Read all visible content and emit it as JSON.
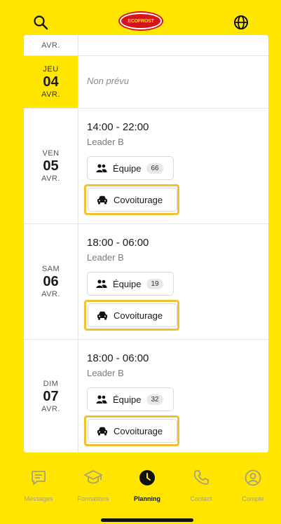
{
  "header": {
    "logo_text": "ECOFROST"
  },
  "colors": {
    "accent": "#ffe500",
    "highlight": "#f2c12e",
    "logo_red": "#d8141b"
  },
  "partial_row": {
    "month": "AVR."
  },
  "days": [
    {
      "dow": "JEU",
      "day": "04",
      "month": "AVR.",
      "unplanned": "Non prévu"
    },
    {
      "dow": "VEN",
      "day": "05",
      "month": "AVR.",
      "time": "14:00 - 22:00",
      "role": "Leader B",
      "team_label": "Équipe",
      "team_count": "66",
      "car_label": "Covoiturage"
    },
    {
      "dow": "SAM",
      "day": "06",
      "month": "AVR.",
      "time": "18:00 - 06:00",
      "role": "Leader B",
      "team_label": "Équipe",
      "team_count": "19",
      "car_label": "Covoiturage"
    },
    {
      "dow": "DIM",
      "day": "07",
      "month": "AVR.",
      "time": "18:00 - 06:00",
      "role": "Leader B",
      "team_label": "Équipe",
      "team_count": "32",
      "car_label": "Covoiturage"
    }
  ],
  "nav": {
    "messages": "Messages",
    "formations": "Formations",
    "planning": "Planning",
    "contact": "Contact",
    "compte": "Compte"
  }
}
